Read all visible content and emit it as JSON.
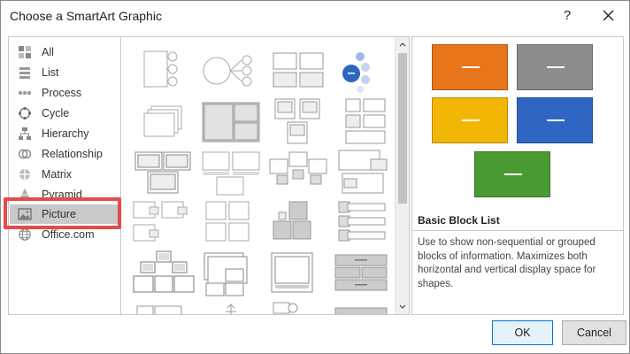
{
  "dialog": {
    "title": "Choose a SmartArt Graphic",
    "help_label": "?",
    "ok_label": "OK",
    "cancel_label": "Cancel"
  },
  "categories": [
    {
      "label": "All",
      "icon": "all-icon"
    },
    {
      "label": "List",
      "icon": "list-icon"
    },
    {
      "label": "Process",
      "icon": "process-icon"
    },
    {
      "label": "Cycle",
      "icon": "cycle-icon"
    },
    {
      "label": "Hierarchy",
      "icon": "hierarchy-icon"
    },
    {
      "label": "Relationship",
      "icon": "relationship-icon"
    },
    {
      "label": "Matrix",
      "icon": "matrix-icon"
    },
    {
      "label": "Pyramid",
      "icon": "pyramid-icon"
    },
    {
      "label": "Picture",
      "icon": "picture-icon",
      "selected": true
    },
    {
      "label": "Office.com",
      "icon": "globe-icon"
    }
  ],
  "preview": {
    "layout_name": "Basic Block List",
    "description": "Use to show non-sequential or grouped blocks of information. Maximizes both horizontal and vertical display space for shapes.",
    "colors": [
      "#e8751a",
      "#8c8c8c",
      "#f2b705",
      "#2f66c3",
      "#4a9a33"
    ]
  },
  "colors": {
    "highlight": "#e64a4a",
    "selected_bg": "#c9c9c9",
    "ok_border": "#0078d7"
  }
}
